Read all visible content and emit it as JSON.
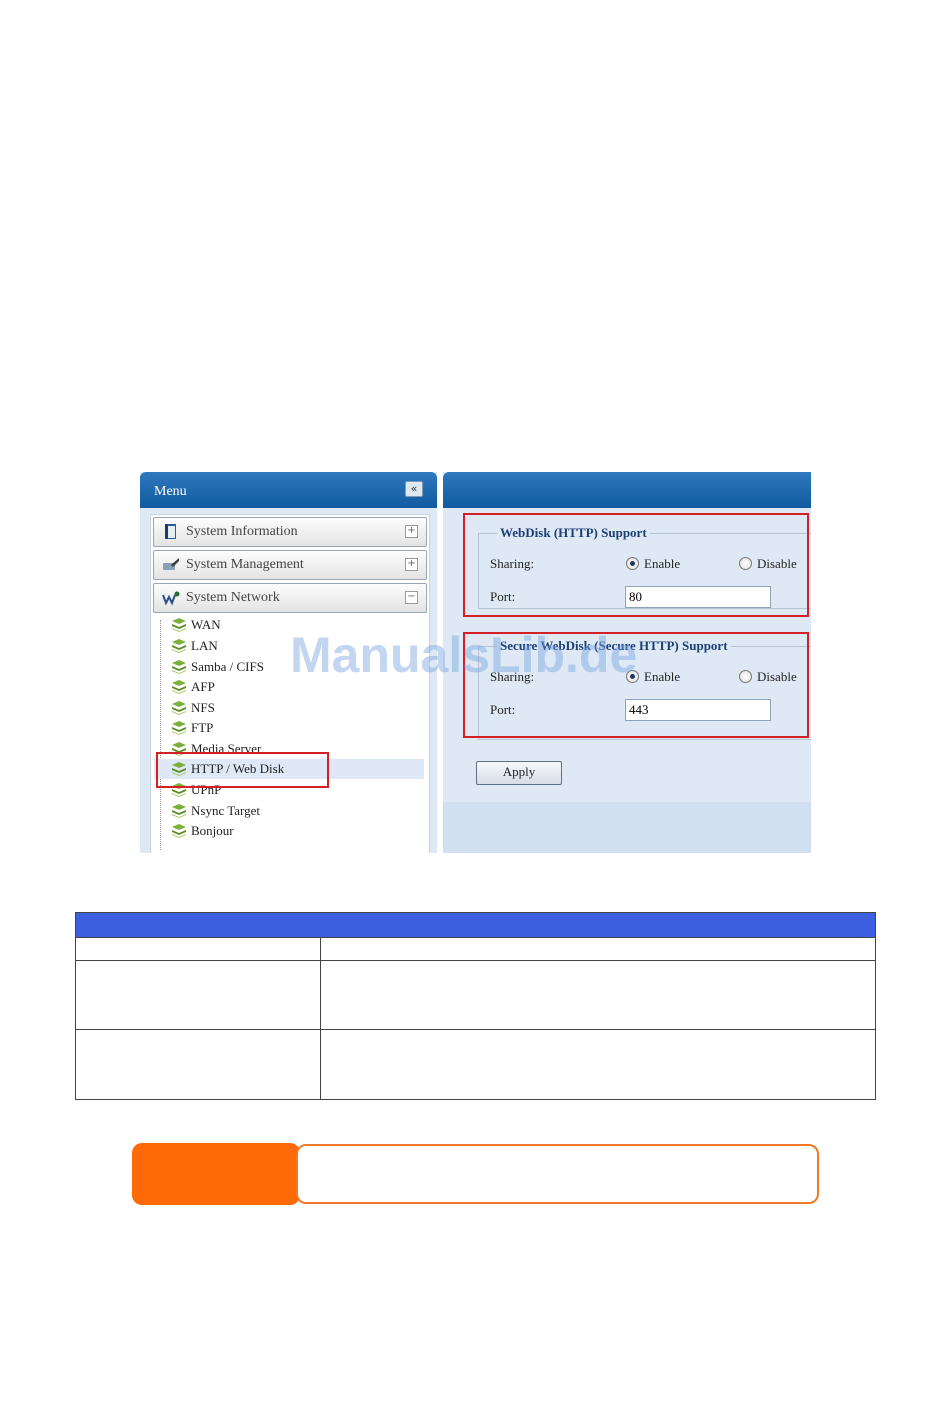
{
  "menu": {
    "title": "Menu",
    "collapse_icon": "«",
    "sections": [
      {
        "label": "System Information",
        "toggle": "+",
        "icon": "info-book-icon"
      },
      {
        "label": "System Management",
        "toggle": "+",
        "icon": "management-icon"
      },
      {
        "label": "System Network",
        "toggle": "−",
        "icon": "network-icon"
      }
    ],
    "network_items": [
      {
        "label": "WAN"
      },
      {
        "label": "LAN"
      },
      {
        "label": "Samba / CIFS"
      },
      {
        "label": "AFP"
      },
      {
        "label": "NFS"
      },
      {
        "label": "FTP"
      },
      {
        "label": "Media Server"
      },
      {
        "label": "HTTP / Web Disk",
        "selected": true
      },
      {
        "label": "UPnP"
      },
      {
        "label": "Nsync Target"
      },
      {
        "label": "Bonjour"
      }
    ]
  },
  "webdisk": {
    "legend": "WebDisk (HTTP) Support",
    "sharing_label": "Sharing:",
    "enable_label": "Enable",
    "disable_label": "Disable",
    "selected": "Enable",
    "port_label": "Port:",
    "port_value": "80"
  },
  "secure_webdisk": {
    "legend": "Secure WebDisk (Secure HTTP) Support",
    "sharing_label": "Sharing:",
    "enable_label": "Enable",
    "disable_label": "Disable",
    "selected": "Enable",
    "port_label": "Port:",
    "port_value": "443"
  },
  "apply_label": "Apply",
  "watermark": "ManualsLib.de",
  "colors": {
    "header_blue": "#1c66ad",
    "panel_bg": "#dfe9f5",
    "highlight_red": "#d31f26",
    "table_header": "#3c5fe0",
    "note_orange": "#ff6a06"
  }
}
